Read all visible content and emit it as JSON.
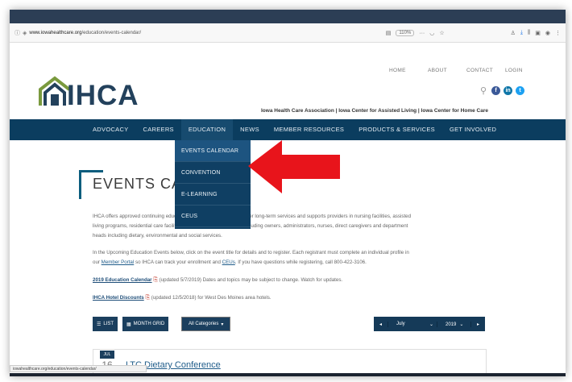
{
  "browser": {
    "url_host": "www.iowahealthcare.org",
    "url_path": "/education/events-calendar/",
    "zoom": "110%",
    "more": "···"
  },
  "header": {
    "top_links": [
      "HOME",
      "ABOUT",
      "CONTACT",
      "LOGIN"
    ],
    "logo_text": "IHCA",
    "tagline": "Iowa Health Care Association | Iowa Center for Assisted Living | Iowa Center for Home Care"
  },
  "nav": {
    "items": [
      "ADVOCACY",
      "CAREERS",
      "EDUCATION",
      "NEWS",
      "MEMBER RESOURCES",
      "PRODUCTS & SERVICES",
      "GET INVOLVED"
    ],
    "active": "EDUCATION"
  },
  "dropdown": {
    "items": [
      "EVENTS CALENDAR",
      "CONVENTION",
      "E-LEARNING",
      "CEUS"
    ]
  },
  "page": {
    "title": "EVENTS CALENDAR",
    "intro_l1": "IHCA offers approved continuing education for member and non-member long-term services and supports providers in nursing facilities, assisted",
    "intro_l2": "living programs, residential care facilities and home health agencies including owners, administrators, nurses, direct caregivers and department",
    "intro_l3": "heads including dietary, environmental and social services.",
    "reg_l1": "In the Upcoming Education Events below, click on the event title for details and to register. Each registrant must complete an individual profile in",
    "reg_l2_a": "our ",
    "member_portal": "Member Portal",
    "reg_l2_b": " so IHCA can track your enrollment and ",
    "ceus": "CEUs",
    "reg_l2_c": ". If you have questions while registering, call 800-422-3106.",
    "cal_link": "2019 Education Calendar",
    "cal_note": "(updated 5/7/2019) Dates and topics may be subject to change. Watch for updates.",
    "hotel_link": "IHCA Hotel Discounts",
    "hotel_note": "(updated 12/5/2018) for West Des Moines area hotels."
  },
  "controls": {
    "list": "LIST",
    "month_grid": "MONTH GRID",
    "categories": "All Categories",
    "month": "July",
    "year": "2019"
  },
  "event": {
    "badge": "JUL",
    "day": "16",
    "title": "LTC Dietary Conference"
  },
  "status_url": "iowahealthcare.org/education/events-calendar/",
  "colors": {
    "nav_bg": "#0b3d5f",
    "arrow": "#e8141b",
    "link": "#1f5c8a"
  }
}
